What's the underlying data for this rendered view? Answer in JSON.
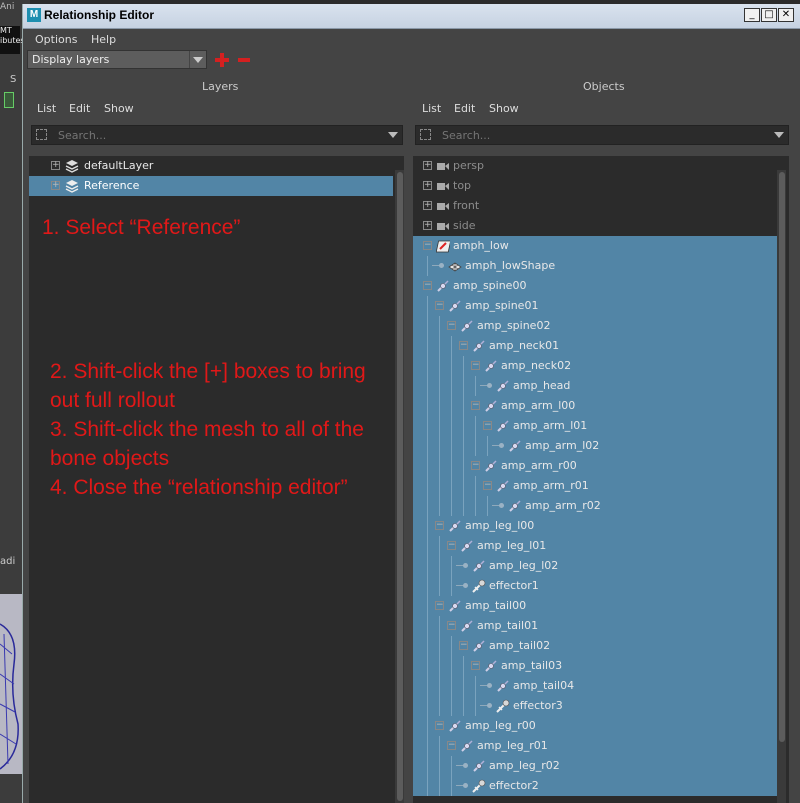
{
  "background": {
    "app_fragment": "Ani",
    "logo_text_1": "MT",
    "logo_text_2": "ibutes",
    "sidebar_fragment": "S",
    "lower_fragment": "adi"
  },
  "window": {
    "title": "Relationship Editor",
    "app_icon_letter": "M",
    "minimize": "_",
    "maximize": "□",
    "close": "✕"
  },
  "menubar": {
    "options": "Options",
    "help": "Help"
  },
  "mode_select": {
    "value": "Display layers"
  },
  "colors": {
    "selection": "#5285a6",
    "annotation": "#e11818",
    "panel_bg": "#2b2b2b",
    "window_bg": "#444444"
  },
  "layers_panel": {
    "header": "Layers",
    "menu": {
      "list": "List",
      "edit": "Edit",
      "show": "Show"
    },
    "search_placeholder": "Search...",
    "items": [
      {
        "label": "defaultLayer",
        "selected": false
      },
      {
        "label": "Reference",
        "selected": true
      }
    ]
  },
  "objects_panel": {
    "header": "Objects",
    "menu": {
      "list": "List",
      "edit": "Edit",
      "show": "Show"
    },
    "search_placeholder": "Search..."
  },
  "annotations": {
    "step1": "1. Select “Reference”",
    "step2_line1": "2. Shift-click the [+] boxes to bring",
    "step2_line2": "out full rollout",
    "step3_line1": "3. Shift-click the mesh to all of the",
    "step3_line2": "bone objects",
    "step4": "4. Close the “relationship editor”"
  },
  "objects": [
    {
      "label": "persp",
      "depth": 0,
      "icon": "camera-icon",
      "expander": "plus",
      "selected": false
    },
    {
      "label": "top",
      "depth": 0,
      "icon": "camera-icon",
      "expander": "plus",
      "selected": false
    },
    {
      "label": "front",
      "depth": 0,
      "icon": "camera-icon",
      "expander": "plus",
      "selected": false
    },
    {
      "label": "side",
      "depth": 0,
      "icon": "camera-icon",
      "expander": "plus",
      "selected": false
    },
    {
      "label": "amph_low",
      "depth": 0,
      "icon": "transform-icon",
      "expander": "minus",
      "selected": true
    },
    {
      "label": "amph_lowShape",
      "depth": 1,
      "icon": "mesh-icon",
      "expander": "leaf",
      "selected": true
    },
    {
      "label": "amp_spine00",
      "depth": 0,
      "icon": "joint-icon",
      "expander": "minus",
      "selected": true
    },
    {
      "label": "amp_spine01",
      "depth": 1,
      "icon": "joint-icon",
      "expander": "minus",
      "selected": true
    },
    {
      "label": "amp_spine02",
      "depth": 2,
      "icon": "joint-icon",
      "expander": "minus",
      "selected": true
    },
    {
      "label": "amp_neck01",
      "depth": 3,
      "icon": "joint-icon",
      "expander": "minus",
      "selected": true
    },
    {
      "label": "amp_neck02",
      "depth": 4,
      "icon": "joint-icon",
      "expander": "minus",
      "selected": true
    },
    {
      "label": "amp_head",
      "depth": 5,
      "icon": "joint-icon",
      "expander": "leaf",
      "selected": true
    },
    {
      "label": "amp_arm_l00",
      "depth": 4,
      "icon": "joint-icon",
      "expander": "minus",
      "selected": true
    },
    {
      "label": "amp_arm_l01",
      "depth": 5,
      "icon": "joint-icon",
      "expander": "minus",
      "selected": true
    },
    {
      "label": "amp_arm_l02",
      "depth": 6,
      "icon": "joint-icon",
      "expander": "leaf",
      "selected": true
    },
    {
      "label": "amp_arm_r00",
      "depth": 4,
      "icon": "joint-icon",
      "expander": "minus",
      "selected": true
    },
    {
      "label": "amp_arm_r01",
      "depth": 5,
      "icon": "joint-icon",
      "expander": "minus",
      "selected": true
    },
    {
      "label": "amp_arm_r02",
      "depth": 6,
      "icon": "joint-icon",
      "expander": "leaf",
      "selected": true
    },
    {
      "label": "amp_leg_l00",
      "depth": 1,
      "icon": "joint-icon",
      "expander": "minus",
      "selected": true
    },
    {
      "label": "amp_leg_l01",
      "depth": 2,
      "icon": "joint-icon",
      "expander": "minus",
      "selected": true
    },
    {
      "label": "amp_leg_l02",
      "depth": 3,
      "icon": "joint-icon",
      "expander": "leaf",
      "selected": true
    },
    {
      "label": "effector1",
      "depth": 3,
      "icon": "effector-icon",
      "expander": "leaf",
      "selected": true
    },
    {
      "label": "amp_tail00",
      "depth": 1,
      "icon": "joint-icon",
      "expander": "minus",
      "selected": true
    },
    {
      "label": "amp_tail01",
      "depth": 2,
      "icon": "joint-icon",
      "expander": "minus",
      "selected": true
    },
    {
      "label": "amp_tail02",
      "depth": 3,
      "icon": "joint-icon",
      "expander": "minus",
      "selected": true
    },
    {
      "label": "amp_tail03",
      "depth": 4,
      "icon": "joint-icon",
      "expander": "minus",
      "selected": true
    },
    {
      "label": "amp_tail04",
      "depth": 5,
      "icon": "joint-icon",
      "expander": "leaf",
      "selected": true
    },
    {
      "label": "effector3",
      "depth": 5,
      "icon": "effector-icon",
      "expander": "leaf",
      "selected": true
    },
    {
      "label": "amp_leg_r00",
      "depth": 1,
      "icon": "joint-icon",
      "expander": "minus",
      "selected": true
    },
    {
      "label": "amp_leg_r01",
      "depth": 2,
      "icon": "joint-icon",
      "expander": "minus",
      "selected": true
    },
    {
      "label": "amp_leg_r02",
      "depth": 3,
      "icon": "joint-icon",
      "expander": "leaf",
      "selected": true
    },
    {
      "label": "effector2",
      "depth": 3,
      "icon": "effector-icon",
      "expander": "leaf",
      "selected": true
    }
  ]
}
